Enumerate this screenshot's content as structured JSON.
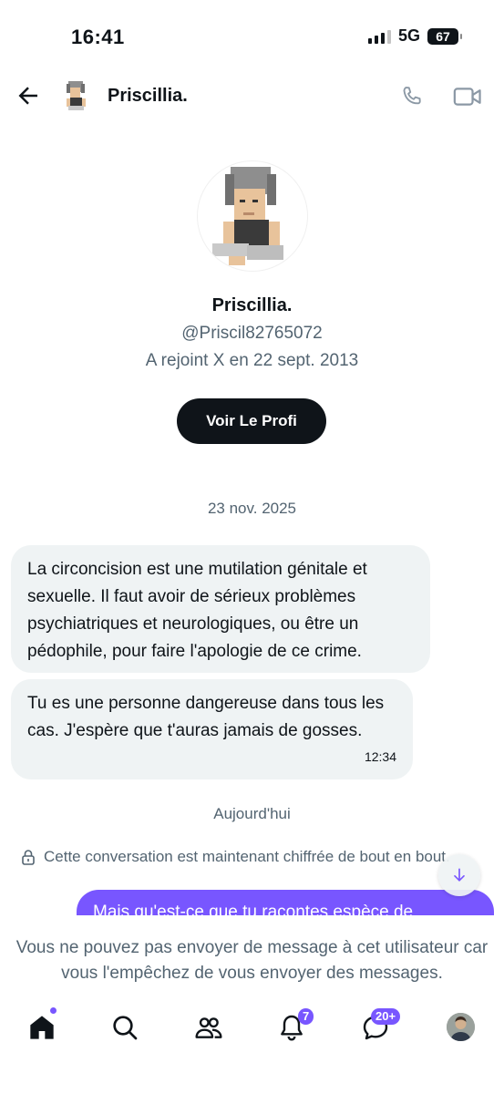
{
  "status_bar": {
    "time": "16:41",
    "network": "5G",
    "battery": "67"
  },
  "header": {
    "name": "Priscillia.",
    "icons": [
      "back-arrow-icon",
      "phone-icon",
      "video-icon"
    ]
  },
  "profile": {
    "name": "Priscillia.",
    "handle": "@Priscil82765072",
    "joined": "A rejoint X en 22 sept. 2013",
    "button_label": "Voir Le Profi"
  },
  "conversation": {
    "date_1": "23 nov. 2025",
    "messages_in": [
      {
        "text": "La circoncision est une mutilation génitale et sexuelle. Il faut avoir de sérieux problèmes psychiatriques et neurologiques, ou être un pédophile, pour faire l'apologie de ce crime."
      },
      {
        "text": "Tu es une personne dangereuse dans tous les cas. J'espère que t'auras jamais de gosses.",
        "time": "12:34"
      }
    ],
    "date_2": "Aujourd'hui",
    "encryption_notice": "Cette conversation est maintenant chiffrée de bout en bout.",
    "message_out_partial": "Mais qu'est-ce que tu racontes espèce de",
    "blocked_notice": "Vous ne pouvez pas envoyer de message à cet utilisateur car vous l'empêchez de vous envoyer des messages."
  },
  "tabbar": {
    "notifications_badge": "7",
    "messages_badge": "20+",
    "icons": [
      "home-icon",
      "search-icon",
      "communities-icon",
      "notifications-icon",
      "messages-icon"
    ]
  },
  "colors": {
    "accent": "#7856ff",
    "text_primary": "#0f1419",
    "text_secondary": "#536471",
    "bubble_incoming": "#eff3f4",
    "button_dark": "#0f1419"
  }
}
